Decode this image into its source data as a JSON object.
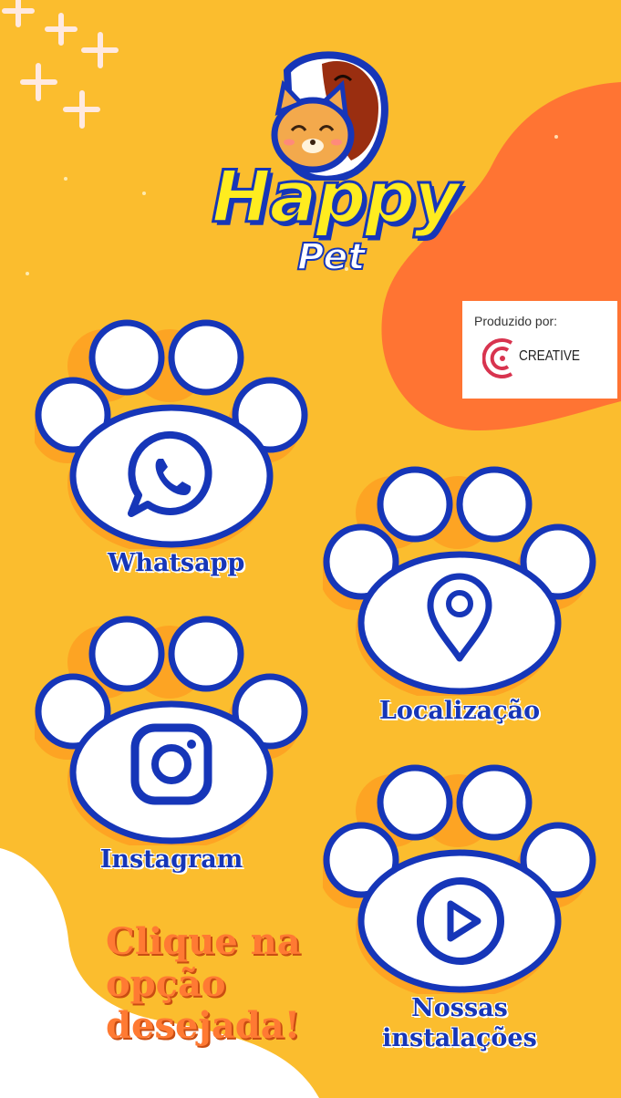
{
  "brand": {
    "title": "Happy",
    "subtitle": "Pet"
  },
  "credit": {
    "label": "Produzido por:",
    "company": "CREATIVE"
  },
  "buttons": {
    "whatsapp": "Whatsapp",
    "location": "Localização",
    "instagram": "Instagram",
    "facilities_line1": "Nossas",
    "facilities_line2": "instalações"
  },
  "cta": {
    "line1": "Clique na",
    "line2": "opção",
    "line3": "desejada!"
  },
  "icons": {
    "whatsapp": "whatsapp-icon",
    "location": "location-pin-icon",
    "instagram": "instagram-icon",
    "facilities": "play-icon",
    "mascot": "cat-dog-mascot",
    "credit_logo": "creative-logo"
  },
  "colors": {
    "background": "#fbbd2e",
    "blob_orange": "#ff7433",
    "primary_blue": "#1636b8",
    "title_yellow": "#ffec1f",
    "cta_orange": "#ff7a33",
    "logo_red": "#d8344f"
  }
}
